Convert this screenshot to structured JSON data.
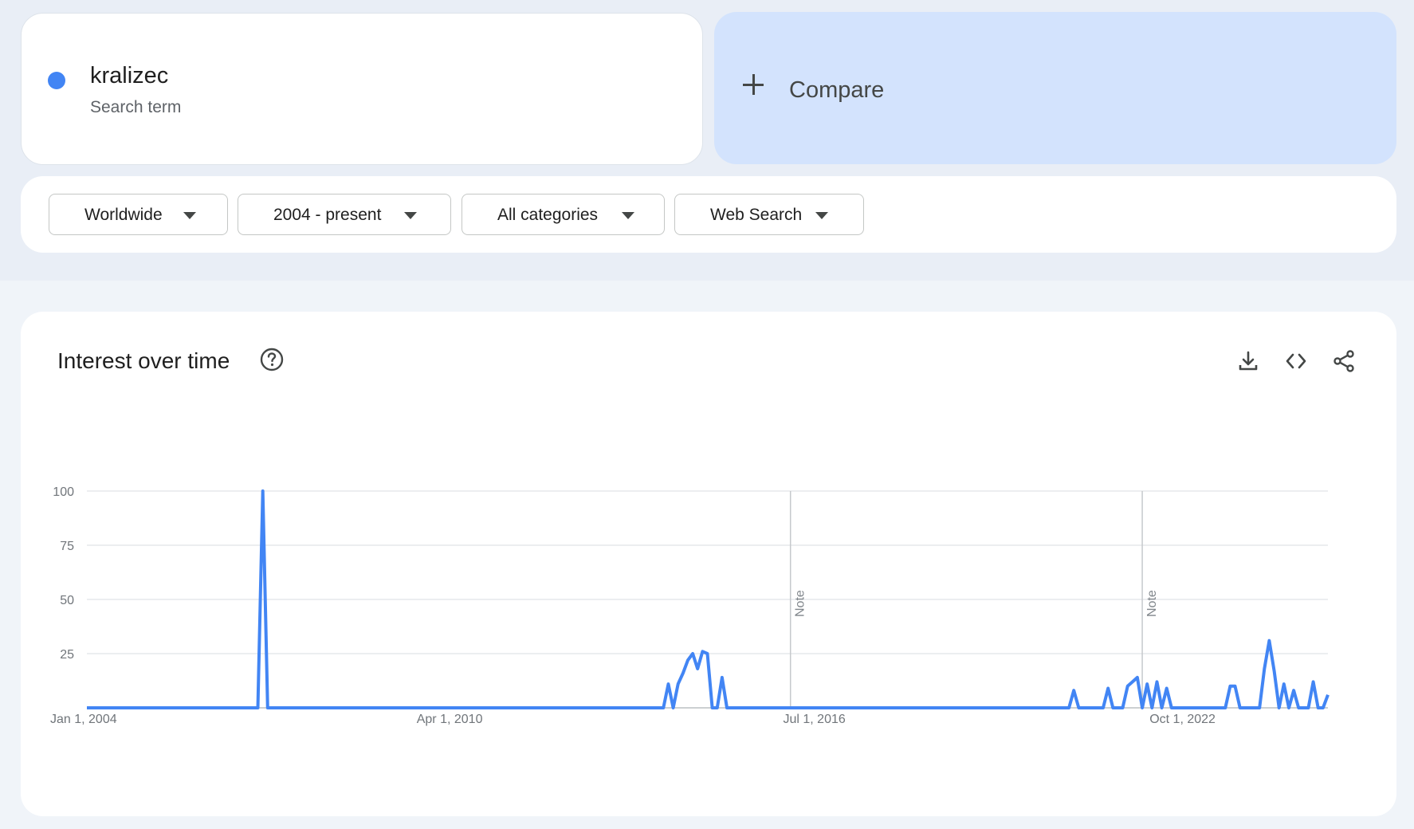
{
  "search_term": {
    "name": "kralizec",
    "type": "Search term",
    "color": "#4285f4"
  },
  "compare": {
    "label": "Compare",
    "icon": "plus-icon"
  },
  "filters": {
    "region": "Worldwide",
    "time_range": "2004 - present",
    "category": "All categories",
    "search_type": "Web Search"
  },
  "chart_section": {
    "title": "Interest over time",
    "help_icon": "help-circle-icon",
    "tools": [
      "download-icon",
      "embed-code-icon",
      "share-icon"
    ]
  },
  "chart_data": {
    "type": "line",
    "title": "",
    "xlabel": "",
    "ylabel": "",
    "ylim": [
      0,
      100
    ],
    "yticks": [
      100,
      75,
      50,
      25
    ],
    "grid": true,
    "xtick_labels": [
      "Jan 1, 2004",
      "Apr 1, 2010",
      "Jul 1, 2016",
      "Oct 1, 2022"
    ],
    "xtick_dates": [
      "2004-01",
      "2010-04",
      "2016-07",
      "2022-10"
    ],
    "notes": [
      {
        "date": "2016-01",
        "label": "Note"
      },
      {
        "date": "2022-01",
        "label": "Note"
      }
    ],
    "series": [
      {
        "color": "#4285f4",
        "points": [
          [
            "2004-01",
            0
          ],
          [
            "2006-12",
            0
          ],
          [
            "2007-01",
            100
          ],
          [
            "2007-02",
            0
          ],
          [
            "2013-11",
            0
          ],
          [
            "2013-12",
            11
          ],
          [
            "2014-01",
            0
          ],
          [
            "2014-02",
            11
          ],
          [
            "2014-03",
            16
          ],
          [
            "2014-04",
            22
          ],
          [
            "2014-05",
            25
          ],
          [
            "2014-06",
            18
          ],
          [
            "2014-07",
            26
          ],
          [
            "2014-08",
            25
          ],
          [
            "2014-09",
            0
          ],
          [
            "2014-10",
            0
          ],
          [
            "2014-11",
            14
          ],
          [
            "2014-12",
            0
          ],
          [
            "2020-10",
            0
          ],
          [
            "2020-11",
            8
          ],
          [
            "2020-12",
            0
          ],
          [
            "2021-05",
            0
          ],
          [
            "2021-06",
            9
          ],
          [
            "2021-07",
            0
          ],
          [
            "2021-09",
            0
          ],
          [
            "2021-10",
            10
          ],
          [
            "2021-11",
            12
          ],
          [
            "2021-12",
            14
          ],
          [
            "2022-01",
            0
          ],
          [
            "2022-02",
            11
          ],
          [
            "2022-03",
            0
          ],
          [
            "2022-04",
            12
          ],
          [
            "2022-05",
            0
          ],
          [
            "2022-06",
            9
          ],
          [
            "2022-07",
            0
          ],
          [
            "2023-06",
            0
          ],
          [
            "2023-07",
            10
          ],
          [
            "2023-08",
            10
          ],
          [
            "2023-09",
            0
          ],
          [
            "2024-01",
            0
          ],
          [
            "2024-02",
            18
          ],
          [
            "2024-03",
            31
          ],
          [
            "2024-04",
            17
          ],
          [
            "2024-05",
            0
          ],
          [
            "2024-06",
            11
          ],
          [
            "2024-07",
            0
          ],
          [
            "2024-08",
            8
          ],
          [
            "2024-09",
            0
          ],
          [
            "2024-11",
            0
          ],
          [
            "2024-12",
            12
          ],
          [
            "2025-01",
            0
          ],
          [
            "2025-02",
            0
          ],
          [
            "2025-03",
            6
          ]
        ]
      }
    ]
  }
}
